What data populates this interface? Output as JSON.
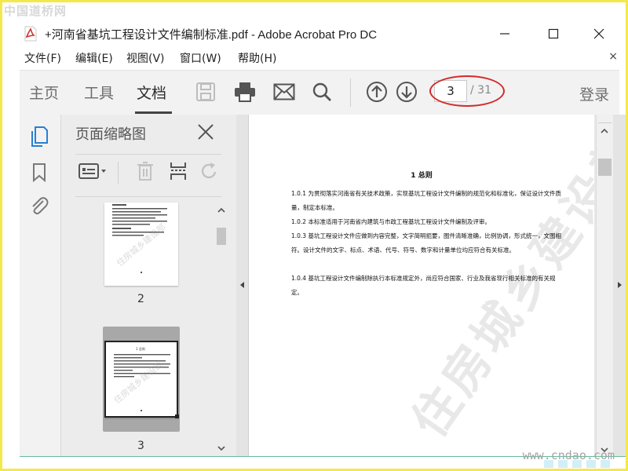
{
  "watermark_site": "中国道桥网",
  "window": {
    "title": "+河南省基坑工程设计文件编制标准.pdf - Adobe Acrobat Pro DC"
  },
  "menu": [
    "文件(F)",
    "编辑(E)",
    "视图(V)",
    "窗口(W)",
    "帮助(H)"
  ],
  "menu_close": "×",
  "toolbar": {
    "tabs": [
      "主页",
      "工具",
      "文档"
    ],
    "active_tab": "文档",
    "page_current": "3",
    "page_total": "/ 31",
    "login": "登录"
  },
  "thumb_panel": {
    "title": "页面缩略图",
    "thumbs": [
      {
        "label": "2"
      },
      {
        "label": "3"
      }
    ],
    "thumb_wm": "住房城乡建设部",
    "thumb_heading": "1  总则"
  },
  "document": {
    "heading": "1    总则",
    "paragraphs": [
      "1.0.1 为贯彻落实河南省有关技术政策，实现基坑工程设计文件编制的规范化和标准化，保证设计文件质量，制定本标准。",
      "1.0.2 本标准适用于河南省内建筑与市政工程基坑工程设计文件编制及评审。",
      "1.0.3 基坑工程设计文件应做到内容完整，文字简明扼要，图件清晰准确，比例协调，形式统一，文图相符。设计文件的文字、标点、术语、代号、符号、数字和计量单位均应符合有关标准。",
      "1.0.4 基坑工程设计文件编制除执行本标准规定外，尚应符合国家、行业及我省现行相关标准的有关规定。"
    ],
    "watermark": "住房城乡建设部行业标准"
  },
  "footer_watermark": "www.cndao.com"
}
